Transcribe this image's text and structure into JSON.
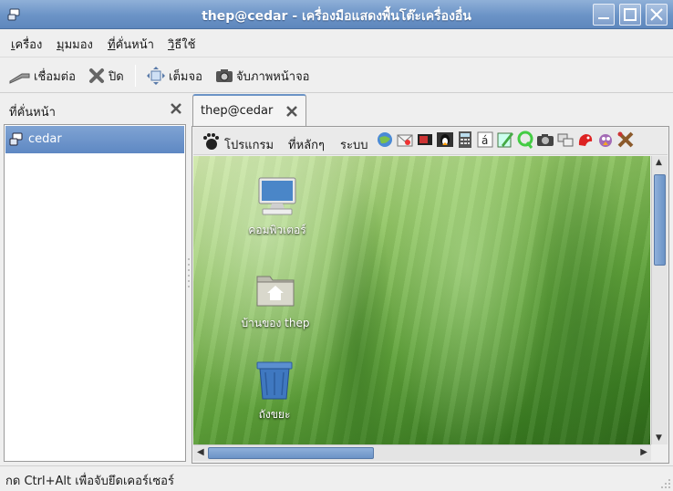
{
  "window": {
    "title": "thep@cedar - เครื่องมือแสดงพื้นโต๊ะเครื่องอื่น",
    "icons": [
      "app-icon",
      "minimize-icon",
      "maximize-icon",
      "close-icon"
    ]
  },
  "menubar": {
    "items": [
      {
        "accel": "เ",
        "rest": "ครื่อง"
      },
      {
        "accel": "มุ",
        "rest": "มมอง"
      },
      {
        "accel": "ที่",
        "rest": "คั่นหน้า"
      },
      {
        "accel": "วิ",
        "rest": "ธีใช้"
      }
    ]
  },
  "toolbar": {
    "connect_label": "เชื่อมต่อ",
    "close_label": "ปิด",
    "fullscreen_label": "เต็มจอ",
    "screenshot_label": "จับภาพหน้าจอ"
  },
  "sidebar": {
    "title": "ที่คั่นหน้า",
    "items": [
      {
        "label": "cedar",
        "selected": true
      }
    ]
  },
  "tabs": [
    {
      "label": "thep@cedar",
      "active": true
    }
  ],
  "remote": {
    "panel_menus": [
      "โปรแกรม",
      "ที่หลักๆ",
      "ระบบ"
    ],
    "launchers": [
      "browser-icon",
      "mail-icon",
      "presentation-icon",
      "terminal-icon",
      "calculator-icon",
      "character-map-icon",
      "text-editor-icon",
      "qt-icon",
      "camera-icon",
      "network-icon",
      "games-icon",
      "chat-icon",
      "tools-icon"
    ],
    "desktop_icons": [
      {
        "label": "คอมพิวเตอร์",
        "icon": "computer-icon"
      },
      {
        "label": "บ้านของ thep",
        "icon": "home-folder-icon"
      },
      {
        "label": "ถังขยะ",
        "icon": "trash-icon"
      }
    ]
  },
  "statusbar": {
    "text": "กด Ctrl+Alt เพื่อจับยึดเคอร์เซอร์"
  },
  "colors": {
    "titlebar": "#6b93c6",
    "selection": "#6b93c6",
    "wallpaper": "#5fa23a"
  }
}
